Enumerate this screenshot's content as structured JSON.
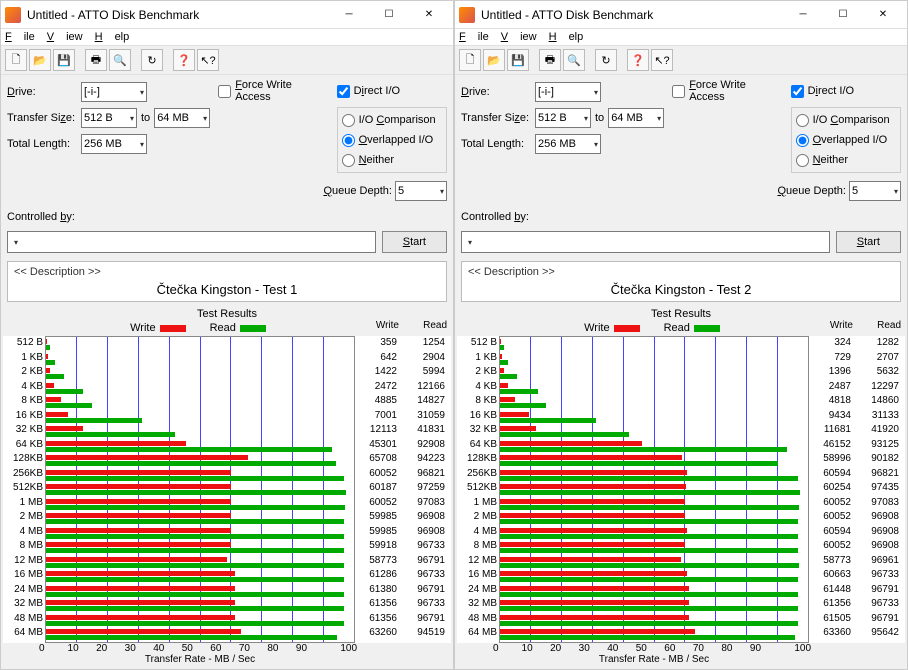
{
  "windows": [
    {
      "title": "Untitled - ATTO Disk Benchmark",
      "menu": {
        "file": "File",
        "view": "View",
        "help": "Help"
      },
      "config": {
        "drive_label": "Drive:",
        "drive_value": "[-i-]",
        "transfer_label": "Transfer Size:",
        "transfer_from": "512 B",
        "to": "to",
        "transfer_to": "64 MB",
        "length_label": "Total Length:",
        "length_value": "256 MB",
        "fwa": "Force Write Access",
        "direct": "Direct I/O",
        "io_comp": "I/O Comparison",
        "overlapped": "Overlapped I/O",
        "neither": "Neither",
        "qd_label": "Queue Depth:",
        "qd_value": "5",
        "controlled_label": "Controlled by:",
        "start": "Start"
      },
      "desc_hdr": "<< Description >>",
      "desc": "Čtečka Kingston - Test 1",
      "results_hdr": "Test Results",
      "legend": {
        "write": "Write",
        "read": "Read"
      },
      "col_write": "Write",
      "col_read": "Read",
      "xlabel": "Transfer Rate - MB / Sec",
      "xticks": [
        "0",
        "10",
        "20",
        "30",
        "40",
        "50",
        "60",
        "70",
        "80",
        "90",
        "100"
      ]
    },
    {
      "title": "Untitled - ATTO Disk Benchmark",
      "menu": {
        "file": "File",
        "view": "View",
        "help": "Help"
      },
      "config": {
        "drive_label": "Drive:",
        "drive_value": "[-i-]",
        "transfer_label": "Transfer Size:",
        "transfer_from": "512 B",
        "to": "to",
        "transfer_to": "64 MB",
        "length_label": "Total Length:",
        "length_value": "256 MB",
        "fwa": "Force Write Access",
        "direct": "Direct I/O",
        "io_comp": "I/O Comparison",
        "overlapped": "Overlapped I/O",
        "neither": "Neither",
        "qd_label": "Queue Depth:",
        "qd_value": "5",
        "controlled_label": "Controlled by:",
        "start": "Start"
      },
      "desc_hdr": "<< Description >>",
      "desc": "Čtečka Kingston - Test 2",
      "results_hdr": "Test Results",
      "legend": {
        "write": "Write",
        "read": "Read"
      },
      "col_write": "Write",
      "col_read": "Read",
      "xlabel": "Transfer Rate - MB / Sec",
      "xticks": [
        "0",
        "10",
        "20",
        "30",
        "40",
        "50",
        "60",
        "70",
        "80",
        "90",
        "100"
      ]
    }
  ],
  "chart_data": [
    {
      "type": "bar",
      "title": "Test Results",
      "xlabel": "Transfer Rate - MB / Sec",
      "ylabel": "Transfer Size",
      "xlim": [
        0,
        100
      ],
      "categories": [
        "512 B",
        "1 KB",
        "2 KB",
        "4 KB",
        "8 KB",
        "16 KB",
        "32 KB",
        "64 KB",
        "128KB",
        "256KB",
        "512KB",
        "1 MB",
        "2 MB",
        "4 MB",
        "8 MB",
        "12 MB",
        "16 MB",
        "24 MB",
        "32 MB",
        "48 MB",
        "64 MB"
      ],
      "series": [
        {
          "name": "Write",
          "values": [
            359,
            642,
            1422,
            2472,
            4885,
            7001,
            12113,
            45301,
            65708,
            60052,
            60187,
            60052,
            59985,
            59985,
            59918,
            58773,
            61286,
            61380,
            61356,
            61356,
            63260
          ]
        },
        {
          "name": "Read",
          "values": [
            1254,
            2904,
            5994,
            12166,
            14827,
            31059,
            41831,
            92908,
            94223,
            96821,
            97259,
            97083,
            96908,
            96908,
            96733,
            96791,
            96733,
            96791,
            96733,
            96791,
            94519
          ]
        }
      ],
      "value_divisor": 1000
    },
    {
      "type": "bar",
      "title": "Test Results",
      "xlabel": "Transfer Rate - MB / Sec",
      "ylabel": "Transfer Size",
      "xlim": [
        0,
        100
      ],
      "categories": [
        "512 B",
        "1 KB",
        "2 KB",
        "4 KB",
        "8 KB",
        "16 KB",
        "32 KB",
        "64 KB",
        "128KB",
        "256KB",
        "512KB",
        "1 MB",
        "2 MB",
        "4 MB",
        "8 MB",
        "12 MB",
        "16 MB",
        "24 MB",
        "32 MB",
        "48 MB",
        "64 MB"
      ],
      "series": [
        {
          "name": "Write",
          "values": [
            324,
            729,
            1396,
            2487,
            4818,
            9434,
            11681,
            46152,
            58996,
            60594,
            60254,
            60052,
            60052,
            60594,
            60052,
            58773,
            60663,
            61448,
            61356,
            61505,
            63360
          ]
        },
        {
          "name": "Read",
          "values": [
            1282,
            2707,
            5632,
            12297,
            14860,
            31133,
            41920,
            93125,
            90182,
            96821,
            97435,
            97083,
            96908,
            96908,
            96908,
            96961,
            96733,
            96791,
            96733,
            96791,
            95642
          ]
        }
      ],
      "value_divisor": 1000
    }
  ]
}
